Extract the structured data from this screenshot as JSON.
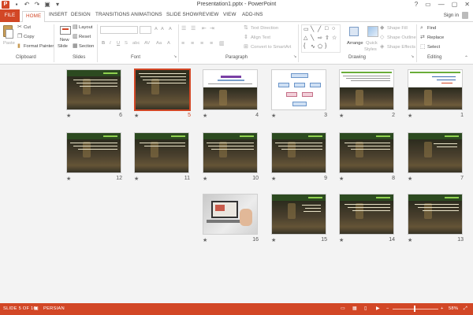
{
  "window": {
    "title": "Presentation1.pptx - PowerPoint",
    "controls": [
      "?",
      "▭",
      "—",
      "▢",
      "✕"
    ]
  },
  "quick_access": [
    "save-icon",
    "undo-icon",
    "redo-icon",
    "start-from-beginning-icon",
    "customize-icon"
  ],
  "tabs": [
    {
      "label": "FILE"
    },
    {
      "label": "HOME"
    },
    {
      "label": "INSERT"
    },
    {
      "label": "DESIGN"
    },
    {
      "label": "TRANSITIONS"
    },
    {
      "label": "ANIMATIONS"
    },
    {
      "label": "SLIDE SHOW"
    },
    {
      "label": "REVIEW"
    },
    {
      "label": "VIEW"
    },
    {
      "label": "ADD-INS"
    }
  ],
  "active_tab": "HOME",
  "sign_in": "Sign in",
  "ribbon": {
    "clipboard": {
      "paste": "Paste",
      "cut": "Cut",
      "copy": "Copy",
      "format_painter": "Format Painter",
      "label": "Clipboard"
    },
    "slides": {
      "new_slide_1": "New",
      "new_slide_2": "Slide",
      "layout": "Layout",
      "reset": "Reset",
      "section": "Section",
      "label": "Slides"
    },
    "font": {
      "font_name": "",
      "font_size": "",
      "increase": "A",
      "decrease": "A",
      "clear": "A",
      "bold": "B",
      "italic": "I",
      "underline": "U",
      "strike": "S",
      "shadow": "abc",
      "spacing": "AV",
      "case": "Aa",
      "color": "A",
      "label": "Font"
    },
    "paragraph": {
      "text_direction": "Text Direction",
      "align_text": "Align Text",
      "smartart": "Convert to SmartArt",
      "label": "Paragraph"
    },
    "drawing": {
      "arrange": "Arrange",
      "quick_styles_1": "Quick",
      "quick_styles_2": "Styles",
      "shape_fill": "Shape Fill",
      "shape_outline": "Shape Outline",
      "shape_effects": "Shape Effects",
      "label": "Drawing"
    },
    "editing": {
      "find": "Find",
      "replace": "Replace",
      "select": "Select",
      "label": "Editing"
    }
  },
  "slides": [
    {
      "number": "1"
    },
    {
      "number": "2"
    },
    {
      "number": "3"
    },
    {
      "number": "4"
    },
    {
      "number": "5"
    },
    {
      "number": "6"
    },
    {
      "number": "7"
    },
    {
      "number": "8"
    },
    {
      "number": "9"
    },
    {
      "number": "10"
    },
    {
      "number": "11"
    },
    {
      "number": "12"
    },
    {
      "number": "13"
    },
    {
      "number": "14"
    },
    {
      "number": "15"
    },
    {
      "number": "16"
    }
  ],
  "selected_slide": "5",
  "status": {
    "slide_position": "SLIDE 5 OF 16",
    "language": "PERSIAN",
    "zoom": "58%"
  },
  "colors": {
    "accent": "#d24726",
    "slide_green": "#6aad3a"
  }
}
